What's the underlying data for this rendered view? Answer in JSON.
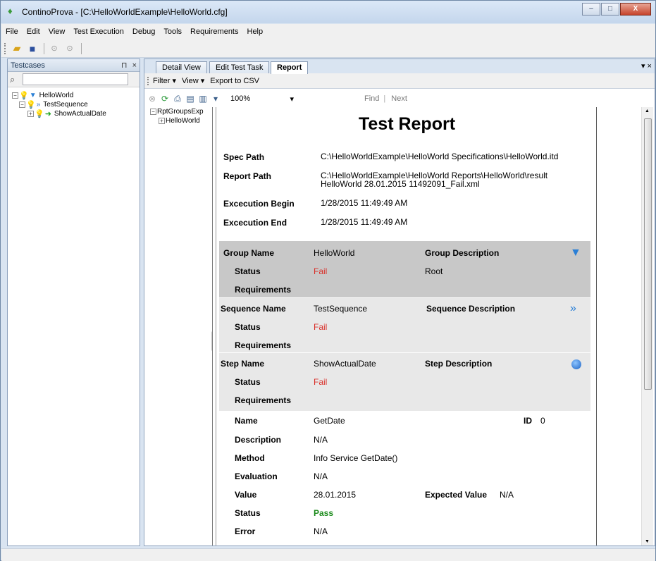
{
  "window": {
    "title": "ContinoProva - [C:\\HelloWorldExample\\HelloWorld.cfg]",
    "controls": {
      "minimize": "–",
      "maximize": "□",
      "close": "X"
    }
  },
  "menu": [
    "File",
    "Edit",
    "View",
    "Test Execution",
    "Debug",
    "Tools",
    "Requirements",
    "Help"
  ],
  "testcases_panel": {
    "title": "Testcases",
    "pin": "⊓",
    "close": "×",
    "search_value": "",
    "tree": [
      {
        "label": "HelloWorld",
        "level": 0,
        "kind": "group"
      },
      {
        "label": "TestSequence",
        "level": 1,
        "kind": "sequence"
      },
      {
        "label": "ShowActualDate",
        "level": 2,
        "kind": "step"
      }
    ]
  },
  "tabs": [
    "Detail View",
    "Edit Test Task",
    "Report"
  ],
  "active_tab": "Report",
  "tabs_menu": "▾ ×",
  "report_toolbar": {
    "filter": "Filter",
    "view": "View",
    "export": "Export to CSV"
  },
  "viewer_toolbar": {
    "zoom": "100%",
    "find": "Find",
    "next": "Next"
  },
  "doc_tree": [
    {
      "label": "RptGroupsExp",
      "level": 0
    },
    {
      "label": "HelloWorld",
      "level": 1
    }
  ],
  "report": {
    "title": "Test Report",
    "meta": [
      {
        "label": "Spec Path",
        "value": "C:\\HelloWorldExample\\HelloWorld Specifications\\HelloWorld.itd"
      },
      {
        "label": "Report Path",
        "value": "C:\\HelloWorldExample\\HelloWorld Reports\\HelloWorld\\result HelloWorld 28.01.2015 11492091_Fail.xml"
      },
      {
        "label": "Excecution Begin",
        "value": "1/28/2015 11:49:49 AM"
      },
      {
        "label": "Excecution End",
        "value": "1/28/2015 11:49:49 AM"
      }
    ],
    "group": {
      "name_label": "Group Name",
      "name": "HelloWorld",
      "desc_label": "Group Description",
      "desc": "Root",
      "status_label": "Status",
      "status": "Fail",
      "req_label": "Requirements"
    },
    "sequence": {
      "name_label": "Sequence Name",
      "name": "TestSequence",
      "desc_label": "Sequence Description",
      "status_label": "Status",
      "status": "Fail",
      "req_label": "Requirements"
    },
    "step": {
      "name_label": "Step Name",
      "name": "ShowActualDate",
      "desc_label": "Step Description",
      "status_label": "Status",
      "status": "Fail",
      "req_label": "Requirements"
    },
    "detail": {
      "name_label": "Name",
      "name": "GetDate",
      "id_label": "ID",
      "id": "0",
      "description_label": "Description",
      "description": "N/A",
      "method_label": "Method",
      "method": "Info Service GetDate()",
      "evaluation_label": "Evaluation",
      "evaluation": "N/A",
      "value_label": "Value",
      "value": "28.01.2015",
      "expected_label": "Expected Value",
      "expected": "N/A",
      "status_label": "Status",
      "status": "Pass",
      "error_label": "Error",
      "error": "N/A"
    }
  },
  "colors": {
    "fail": "#d9302a",
    "pass": "#1a8a1a",
    "group_bg": "#c8c8c8",
    "section_bg": "#e8e8e8"
  }
}
